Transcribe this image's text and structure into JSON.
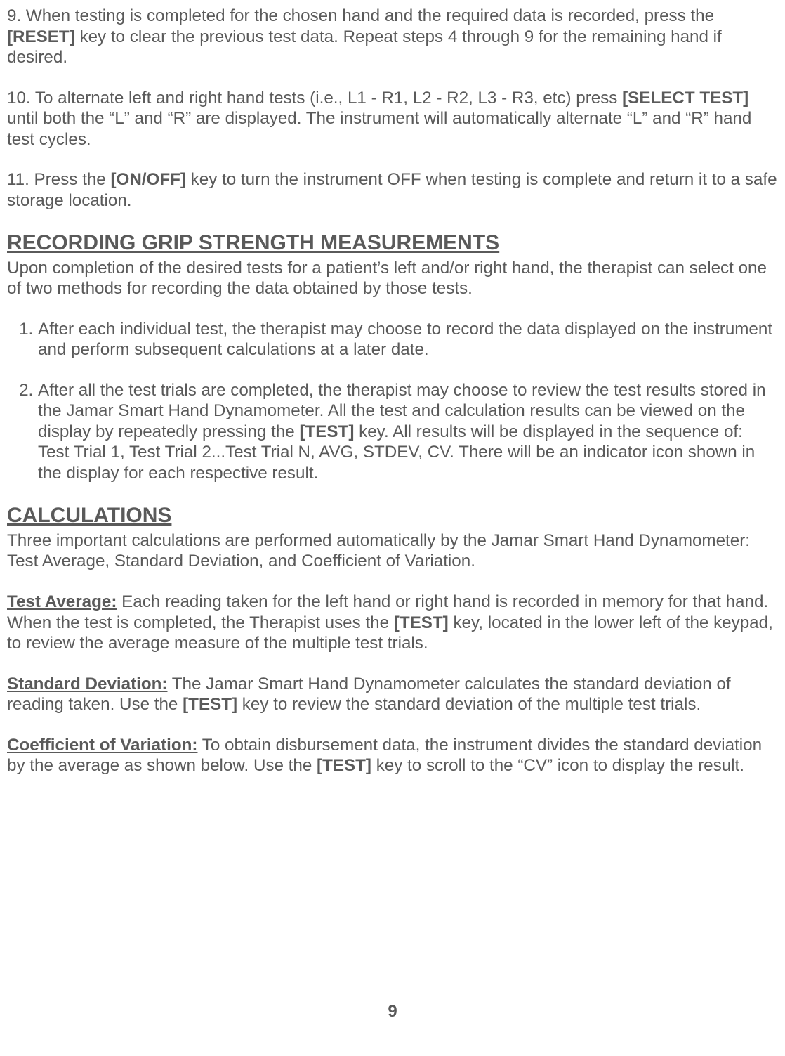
{
  "p9_pre": "9. When testing is completed for the chosen hand and the required data is recorded, press the ",
  "p9_key": "[RESET]",
  "p9_post": " key to clear the previous test data. Repeat steps 4 through 9 for the remaining hand if desired.",
  "p10_pre": "10. To alternate left and right hand tests (i.e., L1 - R1, L2 - R2, L3 - R3, etc) press ",
  "p10_key": "[SELECT TEST]",
  "p10_post": " until both the “L” and “R” are displayed. The instrument will automatically alternate “L” and “R” hand test cycles.",
  "p11_pre": "11. Press the ",
  "p11_key": "[ON/OFF]",
  "p11_post": " key to turn the instrument OFF when testing is complete and return it to a safe storage location.",
  "h_recording": "RECORDING GRIP STRENGTH MEASUREMENTS",
  "rec_intro": "Upon completion of the desired tests for a patient’s left and/or right hand, the therapist can select one of two methods for recording the data obtained by those tests.",
  "rec_item1": "After each individual test, the therapist may choose to record the data displayed on the instrument and perform subsequent calculations at a later date.",
  "rec_item2_pre": "After all the test trials are completed, the therapist may choose to review the test results stored in the Jamar Smart Hand Dynamometer. All the test and calculation results can be viewed on the display by repeatedly pressing the ",
  "rec_item2_key": "[TEST]",
  "rec_item2_post": " key. All results will be displayed in the sequence of: Test Trial 1, Test Trial 2...Test Trial N, AVG, STDEV, CV. There will be an indicator icon shown in the display for each respective result.",
  "h_calc": "CALCULATIONS",
  "calc_intro": "Three important calculations are performed automatically by the Jamar Smart Hand Dynamometer: Test Average, Standard Deviation, and Coefficient of Variation.",
  "ta_label": "Test Average:",
  "ta_pre": "  Each reading taken for the left hand or right hand is recorded in memory for that hand. When the test is completed, the Therapist uses the ",
  "ta_key": "[TEST]",
  "ta_post": " key, located in the lower left of the keypad, to review the average measure of the multiple test trials.",
  "sd_label": "Standard Deviation:",
  "sd_pre": "  The Jamar Smart Hand Dynamometer calculates the standard deviation of reading taken. Use the ",
  "sd_key": "[TEST]",
  "sd_post": " key to review the standard deviation of the multiple test trials.",
  "cv_label": "Coefficient of Variation:",
  "cv_pre": " To obtain disbursement data, the instrument divides the standard deviation by the average as shown below. Use the ",
  "cv_key": "[TEST]",
  "cv_post": " key to scroll to the “CV” icon to display the result.",
  "page_number": "9"
}
